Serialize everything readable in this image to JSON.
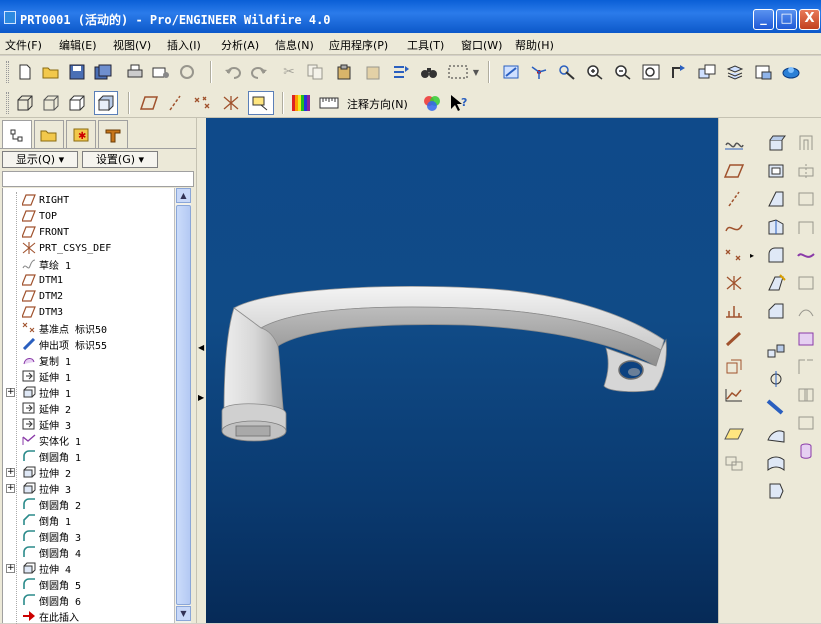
{
  "window": {
    "title": "PRT0001 (活动的) - Pro/ENGINEER Wildfire 4.0",
    "minimize": "_",
    "maximize": "□",
    "close": "X"
  },
  "menu": [
    "文件(F)",
    "编辑(E)",
    "视图(V)",
    "插入(I)",
    "分析(A)",
    "信息(N)",
    "应用程序(P)",
    "工具(T)",
    "窗口(W)",
    "帮助(H)"
  ],
  "toolbar2": {
    "annotation_direction": "注释方向(N)"
  },
  "panel": {
    "show_button": "显示(Q) ▾",
    "settings_button": "设置(G) ▾"
  },
  "tree": [
    {
      "label": "RIGHT",
      "icon": "datum-plane-icon",
      "expandable": false
    },
    {
      "label": "TOP",
      "icon": "datum-plane-icon",
      "expandable": false
    },
    {
      "label": "FRONT",
      "icon": "datum-plane-icon",
      "expandable": false
    },
    {
      "label": "PRT_CSYS_DEF",
      "icon": "csys-icon",
      "expandable": false
    },
    {
      "label": "草绘 1",
      "icon": "sketch-icon",
      "expandable": false
    },
    {
      "label": "DTM1",
      "icon": "datum-plane-icon",
      "expandable": false
    },
    {
      "label": "DTM2",
      "icon": "datum-plane-icon",
      "expandable": false
    },
    {
      "label": "DTM3",
      "icon": "datum-plane-icon",
      "expandable": false
    },
    {
      "label": "基准点 标识50",
      "icon": "datum-point-icon",
      "expandable": false
    },
    {
      "label": "伸出项 标识55",
      "icon": "protrusion-icon",
      "expandable": false
    },
    {
      "label": "复制 1",
      "icon": "copy-icon",
      "expandable": false
    },
    {
      "label": "延伸 1",
      "icon": "extend-icon",
      "expandable": false
    },
    {
      "label": "拉伸 1",
      "icon": "extrude-icon",
      "expandable": true
    },
    {
      "label": "延伸 2",
      "icon": "extend-icon",
      "expandable": false
    },
    {
      "label": "延伸 3",
      "icon": "extend-icon",
      "expandable": false
    },
    {
      "label": "实体化 1",
      "icon": "solidify-icon",
      "expandable": false
    },
    {
      "label": "倒圆角 1",
      "icon": "round-icon",
      "expandable": false
    },
    {
      "label": "拉伸 2",
      "icon": "extrude-icon",
      "expandable": true
    },
    {
      "label": "拉伸 3",
      "icon": "extrude-icon",
      "expandable": true
    },
    {
      "label": "倒圆角 2",
      "icon": "round-icon",
      "expandable": false
    },
    {
      "label": "倒角 1",
      "icon": "chamfer-icon",
      "expandable": false
    },
    {
      "label": "倒圆角 3",
      "icon": "round-icon",
      "expandable": false
    },
    {
      "label": "倒圆角 4",
      "icon": "round-icon",
      "expandable": false
    },
    {
      "label": "拉伸 4",
      "icon": "extrude-icon",
      "expandable": true
    },
    {
      "label": "倒圆角 5",
      "icon": "round-icon",
      "expandable": false
    },
    {
      "label": "倒圆角 6",
      "icon": "round-icon",
      "expandable": false
    },
    {
      "label": "在此插入",
      "icon": "insert-here-arrow-icon",
      "expandable": false
    }
  ],
  "colors": {
    "title_bar": "#0a5fd6",
    "viewport_top": "#0f4a8a",
    "viewport_bottom": "#062a57",
    "model": "#d8d8d8"
  }
}
